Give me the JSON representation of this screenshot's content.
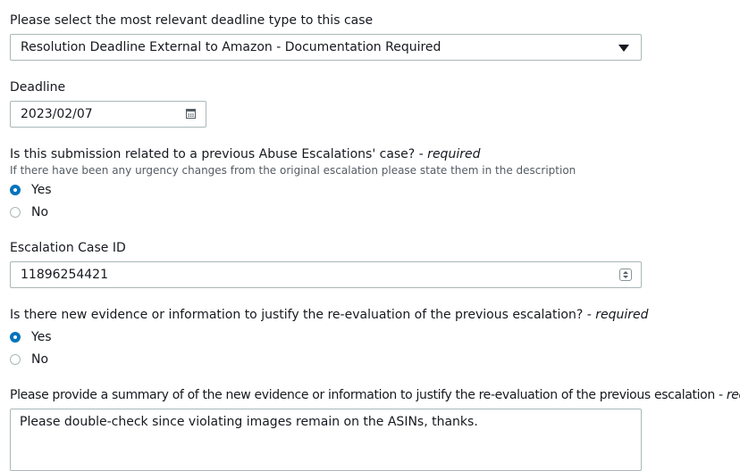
{
  "deadline_type": {
    "label": "Please select the most relevant deadline type to this case",
    "selected": "Resolution Deadline External to Amazon - Documentation Required"
  },
  "deadline": {
    "label": "Deadline",
    "value": "2023/02/07",
    "icon": "calendar-icon"
  },
  "previous_case": {
    "label": "Is this submission related to a previous Abuse Escalations' case?",
    "required": " - required",
    "help": "If there have been any urgency changes from the original escalation please state them in the description",
    "options": [
      "Yes",
      "No"
    ],
    "selected": "Yes"
  },
  "escalation_case_id": {
    "label": "Escalation Case ID",
    "value": "11896254421",
    "icon": "spinner-icon"
  },
  "new_evidence": {
    "label": "Is there new evidence or information to justify the re-evaluation of the previous escalation?",
    "required": " - required",
    "options": [
      "Yes",
      "No"
    ],
    "selected": "Yes"
  },
  "summary": {
    "label": "Please provide a summary of of the new evidence or information to justify the re-evaluation of the previous escalation",
    "required": " - required",
    "value": "Please double-check since violating images remain on the ASINs, thanks."
  }
}
